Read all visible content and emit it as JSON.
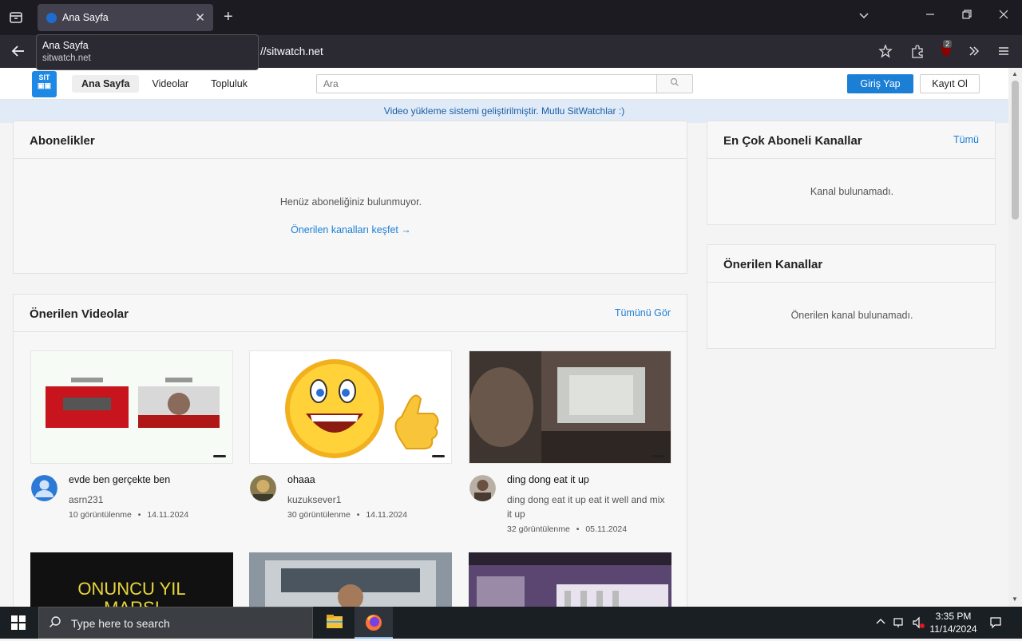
{
  "browser": {
    "tab_title": "Ana Sayfa",
    "tooltip_title": "Ana Sayfa",
    "tooltip_url": "sitwatch.net",
    "url_text": "//sitwatch.net",
    "ext_badge": "2"
  },
  "header": {
    "nav": [
      "Ana Sayfa",
      "Videolar",
      "Topluluk"
    ],
    "search_placeholder": "Ara",
    "login": "Giriş Yap",
    "register": "Kayıt Ol"
  },
  "announcement": "Video yükleme sistemi geliştirilmiştir. Mutlu SitWatchlar :)",
  "subscriptions": {
    "title": "Abonelikler",
    "empty": "Henüz aboneliğiniz bulunmuyor.",
    "discover": "Önerilen kanalları keşfet →"
  },
  "top_channels": {
    "title": "En Çok Aboneli Kanallar",
    "all": "Tümü",
    "empty": "Kanal bulunamadı."
  },
  "recommended_channels": {
    "title": "Önerilen Kanallar",
    "empty": "Önerilen kanal bulunamadı."
  },
  "recommended_videos": {
    "title": "Önerilen Videolar",
    "see_all": "Tümünü Gör",
    "items": [
      {
        "title": "evde ben gerçekte ben",
        "channel": "asrn231",
        "views": "10 görüntülenme",
        "date": "14.11.2024"
      },
      {
        "title": "ohaaa",
        "channel": "kuzuksever1",
        "views": "30 görüntülenme",
        "date": "14.11.2024"
      },
      {
        "title": "ding dong eat it up",
        "channel": "ding dong eat it up eat it well and mix it up",
        "views": "32 görüntülenme",
        "date": "05.11.2024"
      }
    ],
    "row2_thumb_text": "ONUNCU YIL\nMARŞI"
  },
  "taskbar": {
    "search_placeholder": "Type here to search",
    "time": "3:35 PM",
    "date": "11/14/2024"
  }
}
